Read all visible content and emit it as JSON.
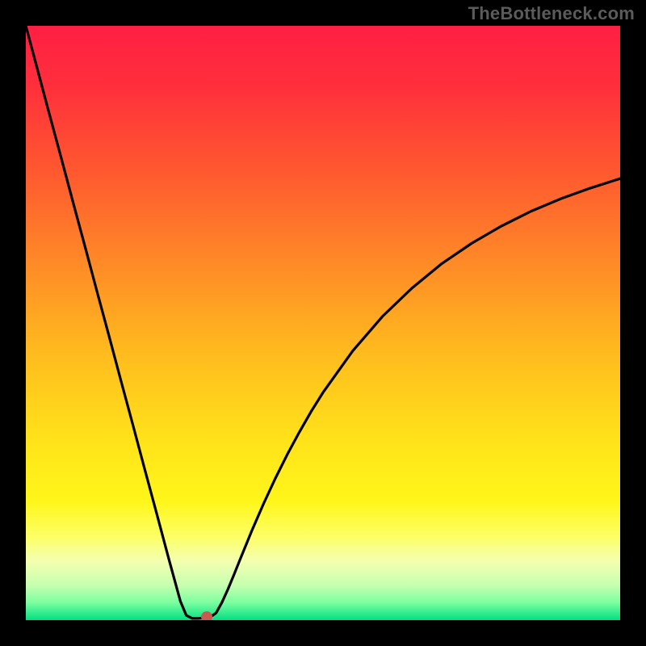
{
  "watermark": "TheBottleneck.com",
  "chart_data": {
    "type": "line",
    "title": "",
    "xlabel": "",
    "ylabel": "",
    "xlim": [
      0,
      100
    ],
    "ylim": [
      0,
      100
    ],
    "gradient_stops": [
      {
        "offset": 0.0,
        "color": "#ff1f43"
      },
      {
        "offset": 0.1,
        "color": "#ff2f3c"
      },
      {
        "offset": 0.25,
        "color": "#ff5a2f"
      },
      {
        "offset": 0.4,
        "color": "#ff8a27"
      },
      {
        "offset": 0.55,
        "color": "#ffbb1e"
      },
      {
        "offset": 0.7,
        "color": "#ffe31a"
      },
      {
        "offset": 0.8,
        "color": "#fff61a"
      },
      {
        "offset": 0.86,
        "color": "#fdff66"
      },
      {
        "offset": 0.9,
        "color": "#f4ffb0"
      },
      {
        "offset": 0.94,
        "color": "#c8ffb0"
      },
      {
        "offset": 0.97,
        "color": "#7dffa0"
      },
      {
        "offset": 1.0,
        "color": "#00e082"
      }
    ],
    "series": [
      {
        "name": "bottleneck-curve",
        "x": [
          0,
          2,
          4,
          6,
          8,
          10,
          12,
          14,
          16,
          18,
          20,
          22,
          24,
          26,
          27,
          28,
          29,
          30,
          31,
          32,
          33,
          34,
          35,
          36,
          38,
          40,
          42,
          44,
          46,
          48,
          50,
          55,
          60,
          65,
          70,
          75,
          80,
          85,
          90,
          95,
          100
        ],
        "y": [
          100,
          92.5,
          85,
          77.6,
          70.1,
          62.7,
          55.2,
          47.8,
          40.3,
          32.9,
          25.4,
          18.0,
          10.5,
          3.2,
          0.8,
          0.3,
          0.3,
          0.4,
          0.5,
          1.2,
          3.0,
          5.2,
          7.6,
          10.1,
          15.0,
          19.6,
          23.9,
          27.9,
          31.6,
          35.1,
          38.3,
          45.3,
          51.1,
          55.9,
          60.0,
          63.4,
          66.3,
          68.8,
          70.9,
          72.7,
          74.3
        ]
      }
    ],
    "marker": {
      "x": 30.5,
      "y": 0.5,
      "color": "#c85a52"
    },
    "grid": false,
    "legend": false
  }
}
